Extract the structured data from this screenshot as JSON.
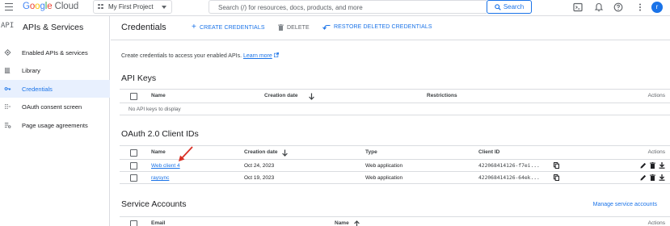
{
  "topbar": {
    "logo_letters": [
      "G",
      "o",
      "o",
      "g",
      "l",
      "e"
    ],
    "logo_suffix": "Cloud",
    "project": "My First Project",
    "search_placeholder": "Search (/) for resources, docs, products, and more",
    "search_button": "Search",
    "avatar_initial": "r"
  },
  "sidebar": {
    "api_glyph": "API",
    "title": "APIs & Services",
    "items": [
      {
        "label": "Enabled APIs & services",
        "icon": "diamond-icon"
      },
      {
        "label": "Library",
        "icon": "library-icon"
      },
      {
        "label": "Credentials",
        "icon": "key-icon"
      },
      {
        "label": "OAuth consent screen",
        "icon": "consent-icon"
      },
      {
        "label": "Page usage agreements",
        "icon": "settings-list-icon"
      }
    ]
  },
  "header": {
    "title": "Credentials",
    "create": "CREATE CREDENTIALS",
    "delete": "DELETE",
    "restore": "RESTORE DELETED CREDENTIALS"
  },
  "description": {
    "text": "Create credentials to access your enabled APIs.",
    "link": "Learn more"
  },
  "api_keys": {
    "title": "API Keys",
    "columns": [
      "Name",
      "Creation date",
      "Restrictions",
      "Actions"
    ],
    "empty": "No API keys to display"
  },
  "oauth": {
    "title": "OAuth 2.0 Client IDs",
    "columns": [
      "Name",
      "Creation date",
      "Type",
      "Client ID",
      "Actions"
    ],
    "rows": [
      {
        "name": "Web client 4",
        "date": "Oct 24, 2023",
        "type": "Web application",
        "client_id": "422068414126-f7ei..."
      },
      {
        "name": "raysync",
        "date": "Oct 19, 2023",
        "type": "Web application",
        "client_id": "422068414126-64ek..."
      }
    ]
  },
  "service_accounts": {
    "title": "Service Accounts",
    "manage": "Manage service accounts",
    "columns": [
      "Email",
      "Name",
      "Actions"
    ]
  },
  "colors": {
    "accent": "#1a73e8",
    "active_bg": "#e8f0fe",
    "border": "#dadce0",
    "arrow": "#d93025"
  }
}
